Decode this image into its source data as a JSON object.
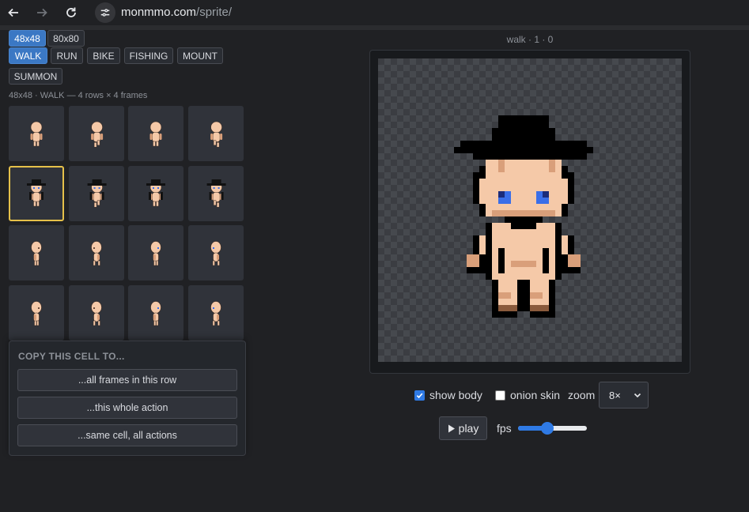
{
  "browser": {
    "url_domain": "monmmo.com",
    "url_path": "/sprite/"
  },
  "sizes": [
    {
      "label": "48x48",
      "active": true
    },
    {
      "label": "80x80",
      "active": false
    }
  ],
  "actions": [
    {
      "label": "WALK",
      "active": true
    },
    {
      "label": "RUN",
      "active": false
    },
    {
      "label": "BIKE",
      "active": false
    },
    {
      "label": "FISHING",
      "active": false
    },
    {
      "label": "MOUNT",
      "active": false
    },
    {
      "label": "SUMMON",
      "active": false
    }
  ],
  "grid_caption": "48x48 · WALK — 4 rows × 4 frames",
  "grid": {
    "rows": 4,
    "cols": 4,
    "selected": {
      "row": 1,
      "col": 0
    },
    "row_content": [
      "body-front",
      "hat-front",
      "body-side",
      "body-side"
    ]
  },
  "copy_panel": {
    "title": "COPY THIS CELL TO...",
    "buttons": [
      "...all frames in this row",
      "...this whole action",
      "...same cell, all actions"
    ]
  },
  "canvas": {
    "title": "walk · 1 · 0"
  },
  "controls": {
    "show_body_label": "show body",
    "show_body_checked": true,
    "onion_skin_label": "onion skin",
    "onion_skin_checked": false,
    "zoom_label": "zoom",
    "zoom_value": "8×",
    "play_label": "play",
    "fps_label": "fps",
    "fps_fraction": 0.41
  },
  "colors": {
    "accent": "#3b78c4",
    "selected_border": "#e6c14a",
    "skin": "#f5c9a8",
    "skin_shade": "#d99f7a",
    "outline": "#000000",
    "eye": "#3a6ee8"
  }
}
